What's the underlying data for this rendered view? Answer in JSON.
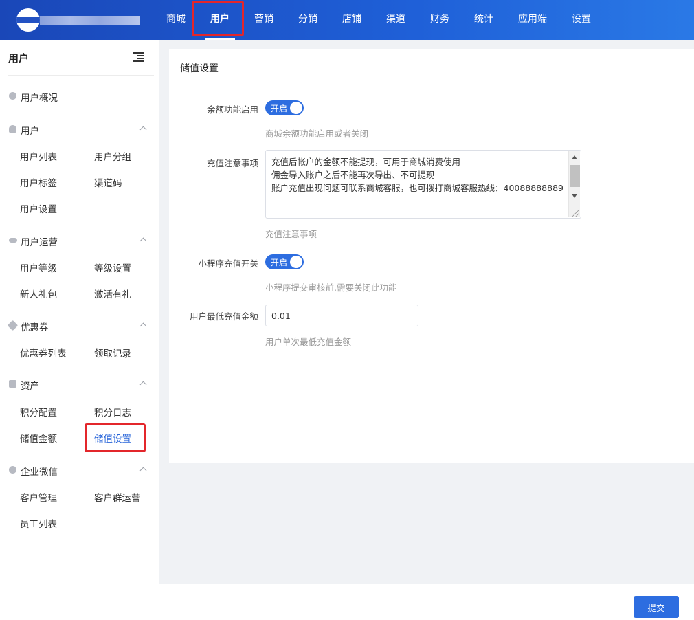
{
  "topnav": {
    "items": [
      {
        "label": "商城"
      },
      {
        "label": "用户"
      },
      {
        "label": "营销"
      },
      {
        "label": "分销"
      },
      {
        "label": "店铺"
      },
      {
        "label": "渠道"
      },
      {
        "label": "财务"
      },
      {
        "label": "统计"
      },
      {
        "label": "应用端"
      },
      {
        "label": "设置"
      }
    ],
    "active": "用户"
  },
  "sidebar": {
    "title": "用户",
    "overview": "用户概况",
    "groups": [
      {
        "label": "用户",
        "icon": "person-icon",
        "items": [
          "用户列表",
          "用户分组",
          "用户标签",
          "渠道码",
          "用户设置"
        ]
      },
      {
        "label": "用户运营",
        "icon": "link-icon",
        "items": [
          "用户等级",
          "等级设置",
          "新人礼包",
          "激活有礼"
        ]
      },
      {
        "label": "优惠券",
        "icon": "tag-icon",
        "items": [
          "优惠券列表",
          "领取记录"
        ]
      },
      {
        "label": "资产",
        "icon": "chart-icon",
        "items": [
          "积分配置",
          "积分日志",
          "储值金额",
          "储值设置"
        ]
      },
      {
        "label": "企业微信",
        "icon": "chat-icon",
        "items": [
          "客户管理",
          "客户群运营",
          "员工列表"
        ]
      }
    ],
    "active_item": "储值设置"
  },
  "panel": {
    "title": "储值设置",
    "balance_enable": {
      "label": "余额功能启用",
      "switch_text": "开启",
      "on": true,
      "tip": "商城余额功能启用或者关闭"
    },
    "recharge_notes": {
      "label": "充值注意事项",
      "lines": [
        "充值后帐户的金额不能提现，可用于商城消费使用",
        "佣金导入账户之后不能再次导出、不可提现",
        "账户充值出现问题可联系商城客服，也可拨打商城客服热线：40088888889"
      ],
      "tip": "充值注意事项"
    },
    "miniprogram_switch": {
      "label": "小程序充值开关",
      "switch_text": "开启",
      "on": true,
      "tip": "小程序提交审核前,需要关闭此功能"
    },
    "min_recharge": {
      "label": "用户最低充值金额",
      "value": "0.01",
      "tip": "用户单次最低充值金额"
    }
  },
  "footer": {
    "submit_label": "提交"
  },
  "colors": {
    "primary": "#2d6de0",
    "highlight": "#e3262b",
    "header": "#1f60d8"
  }
}
